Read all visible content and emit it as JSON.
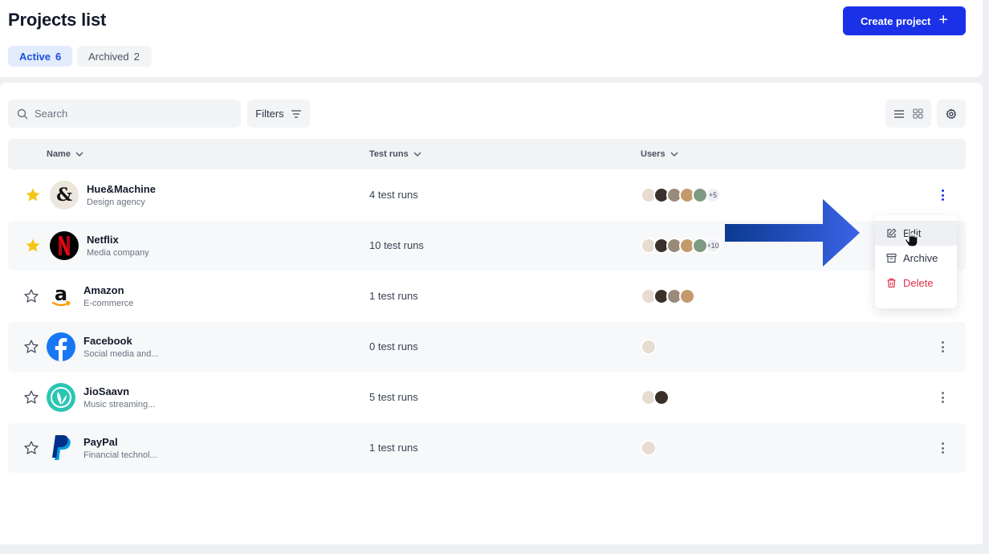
{
  "header": {
    "title": "Projects list",
    "create_label": "Create project",
    "create_icon": "plus-icon"
  },
  "tabs": [
    {
      "label": "Active",
      "count": "6",
      "selected": true
    },
    {
      "label": "Archived",
      "count": "2",
      "selected": false
    }
  ],
  "toolbar": {
    "search_placeholder": "Search",
    "filters_label": "Filters"
  },
  "table": {
    "columns": [
      "Name",
      "Test runs",
      "Users"
    ],
    "rows": [
      {
        "name": "Hue&Machine",
        "subtitle": "Design agency",
        "runs": "4 test runs",
        "starred": true,
        "users_more": "+5",
        "logo": "hue-machine-logo"
      },
      {
        "name": "Netflix",
        "subtitle": "Media company",
        "runs": "10 test runs",
        "starred": true,
        "users_more": "+10",
        "logo": "netflix-logo"
      },
      {
        "name": "Amazon",
        "subtitle": "E-commerce",
        "runs": "1 test runs",
        "starred": false,
        "users_more": "",
        "logo": "amazon-logo"
      },
      {
        "name": "Facebook",
        "subtitle": "Social media and...",
        "runs": "0 test runs",
        "starred": false,
        "users_more": "",
        "logo": "facebook-logo"
      },
      {
        "name": "JioSaavn",
        "subtitle": "Music streaming...",
        "runs": "5 test runs",
        "starred": false,
        "users_more": "",
        "logo": "jiosaavn-logo"
      },
      {
        "name": "PayPal",
        "subtitle": "Financial technol...",
        "runs": "1 test runs",
        "starred": false,
        "users_more": "",
        "logo": "paypal-logo"
      }
    ]
  },
  "context_menu": {
    "items": [
      {
        "label": "Edit",
        "icon": "edit-icon"
      },
      {
        "label": "Archive",
        "icon": "archive-icon"
      },
      {
        "label": "Delete",
        "icon": "trash-icon"
      }
    ]
  },
  "colors": {
    "primary": "#1b31e8",
    "star": "#f5c518",
    "danger": "#e02f4a",
    "arrow": "#3a63e6"
  }
}
